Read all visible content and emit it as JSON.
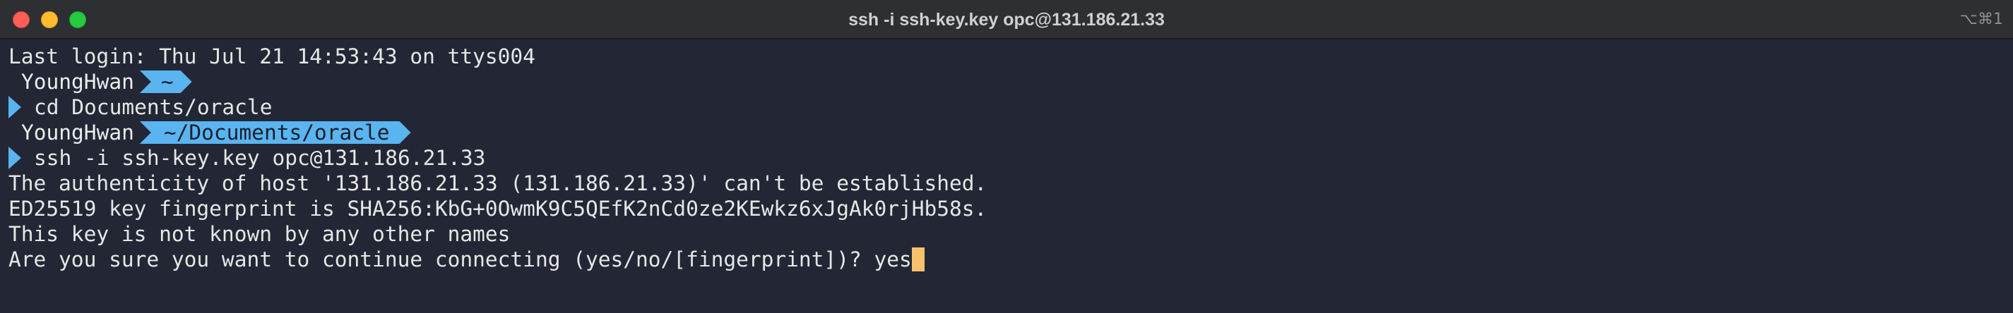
{
  "window": {
    "title": "ssh -i ssh-key.key opc@131.186.21.33",
    "shortcut": "⌥⌘1"
  },
  "prompt": {
    "user": "YoungHwan",
    "caret_color": "#5ab4f0",
    "segment_color": "#5ab4f0",
    "cursor_color": "#f5c26b"
  },
  "terminal": {
    "last_login": "Last login: Thu Jul 21 14:53:43 on ttys004",
    "prompt1_dir": "~",
    "cmd1": "cd Documents/oracle",
    "prompt2_dir": "~/Documents/oracle",
    "cmd2": "ssh -i ssh-key.key opc@131.186.21.33",
    "out1": "The authenticity of host '131.186.21.33 (131.186.21.33)' can't be established.",
    "out2": "ED25519 key fingerprint is SHA256:KbG+0OwmK9C5QEfK2nCd0ze2KEwkz6xJgAk0rjHb58s.",
    "out3": "This key is not known by any other names",
    "out4": "Are you sure you want to continue connecting (yes/no/[fingerprint])? ",
    "typed": "yes"
  }
}
